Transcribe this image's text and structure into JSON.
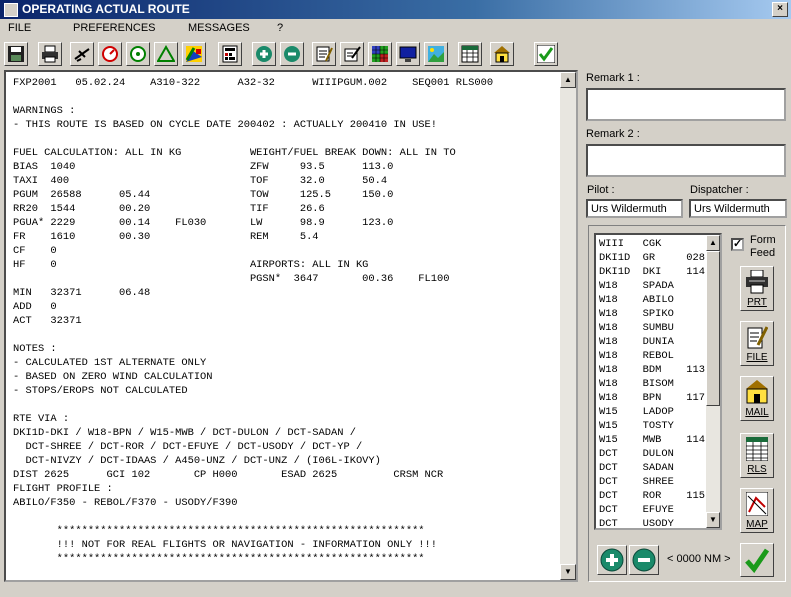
{
  "window": {
    "title": "OPERATING ACTUAL ROUTE",
    "close_glyph": "×"
  },
  "menu": [
    "FILE",
    "PREFERENCES",
    "MESSAGES",
    "?"
  ],
  "toolbar_icons": [
    "save-icon",
    "print-icon",
    "aircraft-icon",
    "red-gauge-icon",
    "green-gauge-icon",
    "triangle-icon",
    "chart-icon",
    "calculator-icon",
    "zoom-in-icon",
    "zoom-out-icon",
    "edit-document-icon",
    "pen-document-icon",
    "grid-map-icon",
    "monitor-icon",
    "landscape-icon",
    "table-icon",
    "home-icon",
    "confirm-check-icon"
  ],
  "route_text": [
    "FXP2001   05.02.24    A310-322      A32-32      WIIIPGUM.002    SEQ001 RLS000",
    "",
    "WARNINGS :",
    "- THIS ROUTE IS BASED ON CYCLE DATE 200402 : ACTUALLY 200410 IN USE!",
    "",
    "FUEL CALCULATION: ALL IN KG           WEIGHT/FUEL BREAK DOWN: ALL IN TO",
    "BIAS  1040                            ZFW     93.5      113.0",
    "TAXI  400                             TOF     32.0      50.4",
    "PGUM  26588      05.44                TOW     125.5     150.0",
    "RR20  1544       00.20                TIF     26.6",
    "PGUA* 2229       00.14    FL030       LW      98.9      123.0",
    "FR    1610       00.30                REM     5.4",
    "CF    0",
    "HF    0                               AIRPORTS: ALL IN KG",
    "                                      PGSN*  3647       00.36    FL100",
    "MIN   32371      06.48",
    "ADD   0",
    "ACT   32371",
    "",
    "NOTES :",
    "- CALCULATED 1ST ALTERNATE ONLY",
    "- BASED ON ZERO WIND CALCULATION",
    "- STOPS/EROPS NOT CALCULATED",
    "",
    "RTE VIA :",
    "DKI1D-DKI / W18-BPN / W15-MWB / DCT-DULON / DCT-SADAN /",
    "  DCT-SHREE / DCT-ROR / DCT-EFUYE / DCT-USODY / DCT-YP /",
    "  DCT-NIVZY / DCT-IDAAS / A450-UNZ / DCT-UNZ / (I06L-IKOVY)",
    "DIST 2625      GCI 102       CP H000       ESAD 2625         CRSM NCR",
    "FLIGHT PROFILE :",
    "ABILO/F350 - REBOL/F370 - USODY/F390",
    "",
    "       ***********************************************************",
    "       !!! NOT FOR REAL FLIGHTS OR NAVIGATION - INFORMATION ONLY !!!",
    "       ***********************************************************"
  ],
  "remark1": {
    "label": "Remark 1 :",
    "value": ""
  },
  "remark2": {
    "label": "Remark 2 :",
    "value": ""
  },
  "pilot": {
    "label": "Pilot :",
    "value": "Urs Wildermuth"
  },
  "dispatcher": {
    "label": "Dispatcher :",
    "value": "Urs Wildermuth"
  },
  "route_list": [
    "WIII   CGK",
    "DKI1D  GR     028",
    "DKI1D  DKI    114",
    "W18    SPADA",
    "W18    ABILO",
    "W18    SPIKO",
    "W18    SUMBU",
    "W18    DUNIA",
    "W18    REBOL",
    "W18    BDM    113",
    "W18    BISOM",
    "W18    BPN    117",
    "W15    LADOP",
    "W15    TOSTY",
    "W15    MWB    114",
    "DCT    DULON",
    "DCT    SADAN",
    "DCT    SHREE",
    "DCT    ROR    115",
    "DCT    EFUYE",
    "DCT    USODY"
  ],
  "form_feed": {
    "label_line1": "Form",
    "label_line2": "Feed",
    "checked": true,
    "check_glyph": "✓"
  },
  "side_buttons": {
    "print": "PRT",
    "file": "FILE",
    "mail": "MAIL",
    "release": "RLS",
    "map": "MAP"
  },
  "nm_display": "< 0000 NM >",
  "colors": {
    "title_start": "#0a246a",
    "title_end": "#a6caf0",
    "confirm_green": "#1a9a1a",
    "plus_minus_teal": "#1a8a6a"
  }
}
